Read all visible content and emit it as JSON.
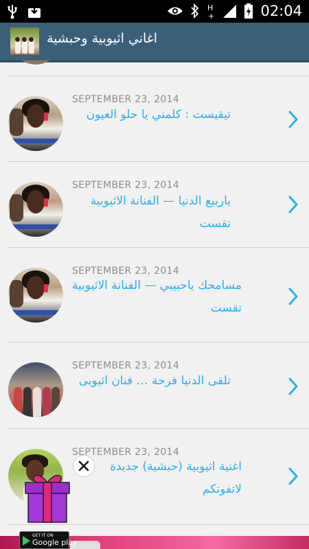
{
  "statusbar": {
    "time": "02:04",
    "icons": [
      "usb-icon",
      "download-icon",
      "eye-icon",
      "bluetooth-icon",
      "hplus-icon",
      "signal-icon",
      "battery-icon"
    ]
  },
  "actionbar": {
    "title": "اغاني اثيوبية وحبشية",
    "color": "#3a5f79"
  },
  "accent_color": "#29b0e6",
  "posts": [
    {
      "date": "SEPTEMBER 23, 2014",
      "title": "تيقيست : كلمني يا حلو العيون"
    },
    {
      "date": "SEPTEMBER 23, 2014",
      "title": "ياربيع الدنيا — الفنانة الاثيوبية تقست"
    },
    {
      "date": "SEPTEMBER 23, 2014",
      "title": "مسامحك ياحبيبي — الفنانة الاثيوبية تقست"
    },
    {
      "date": "SEPTEMBER 23, 2014",
      "title": "تلقى الدنيا فرحة … فنان اثيوبى"
    },
    {
      "date": "SEPTEMBER 23, 2014",
      "title": "اغنية اثيوبية (حبشية) جديدة لاتفوتكم"
    }
  ],
  "ad": {
    "badge_small": "GET IT ON",
    "badge_big": "Google play"
  }
}
